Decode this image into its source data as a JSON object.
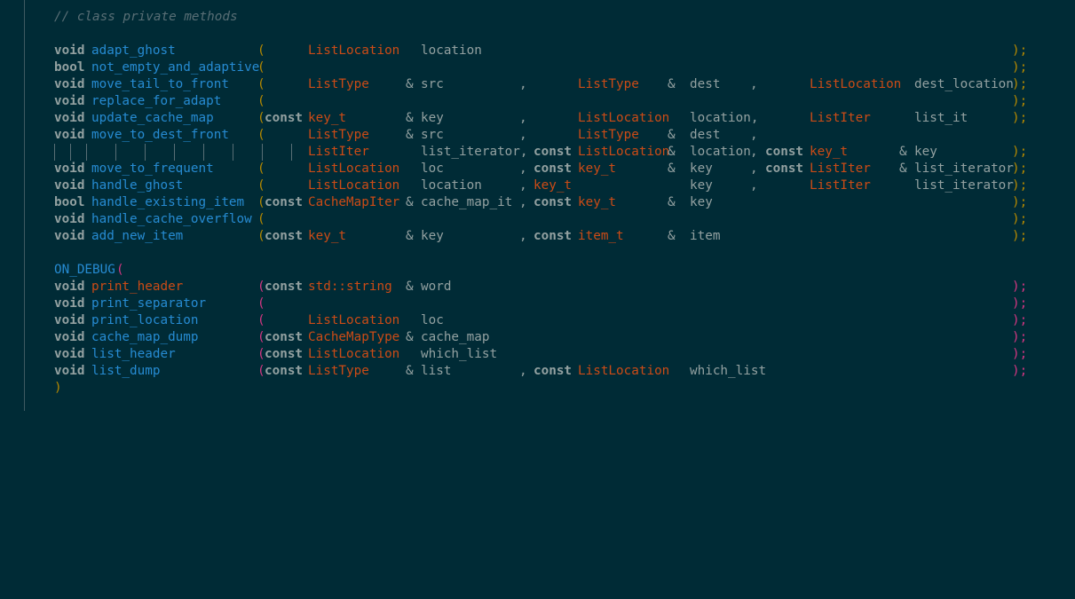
{
  "editor": {
    "comment": "// class private methods",
    "kw": {
      "void": "void",
      "bool": "bool",
      "const": "const"
    },
    "open": "(",
    "close": ")",
    "endstmt": ");",
    "comma": ",",
    "amp": "&",
    "funcs": {
      "adapt_ghost": "adapt_ghost",
      "not_empty_and_adaptive": "not_empty_and_adaptive",
      "move_tail_to_front": "move_tail_to_front",
      "replace_for_adapt": "replace_for_adapt",
      "update_cache_map": "update_cache_map",
      "move_to_dest_front": "move_to_dest_front",
      "move_to_frequent": "move_to_frequent",
      "handle_ghost": "handle_ghost",
      "handle_existing_item": "handle_existing_item",
      "handle_cache_overflow": "handle_cache_overflow",
      "add_new_item": "add_new_item",
      "on_debug": "ON_DEBUG",
      "print_header": "print_header",
      "print_separator": "print_separator",
      "print_location": "print_location",
      "cache_map_dump": "cache_map_dump",
      "list_header": "list_header",
      "list_dump": "list_dump"
    },
    "types": {
      "ListLocation": "ListLocation",
      "ListType": "ListType",
      "key_t": "key_t",
      "ListIter": "ListIter",
      "CacheMapIter": "CacheMapIter",
      "item_t": "item_t",
      "std_string": "std::string",
      "CacheMapType": "CacheMapType"
    },
    "params": {
      "location": "location",
      "location_comma": "location,",
      "src": "src",
      "dest": "dest",
      "dest_location": "dest_location",
      "key": "key",
      "list_it": "list_it",
      "list_iterator": "list_iterator",
      "list_iterator_comma": "list_iterator,",
      "loc": "loc",
      "cache_map_it": "cache_map_it",
      "item": "item",
      "word": "word",
      "cache_map": "cache_map",
      "which_list": "which_list",
      "list": "list"
    }
  }
}
